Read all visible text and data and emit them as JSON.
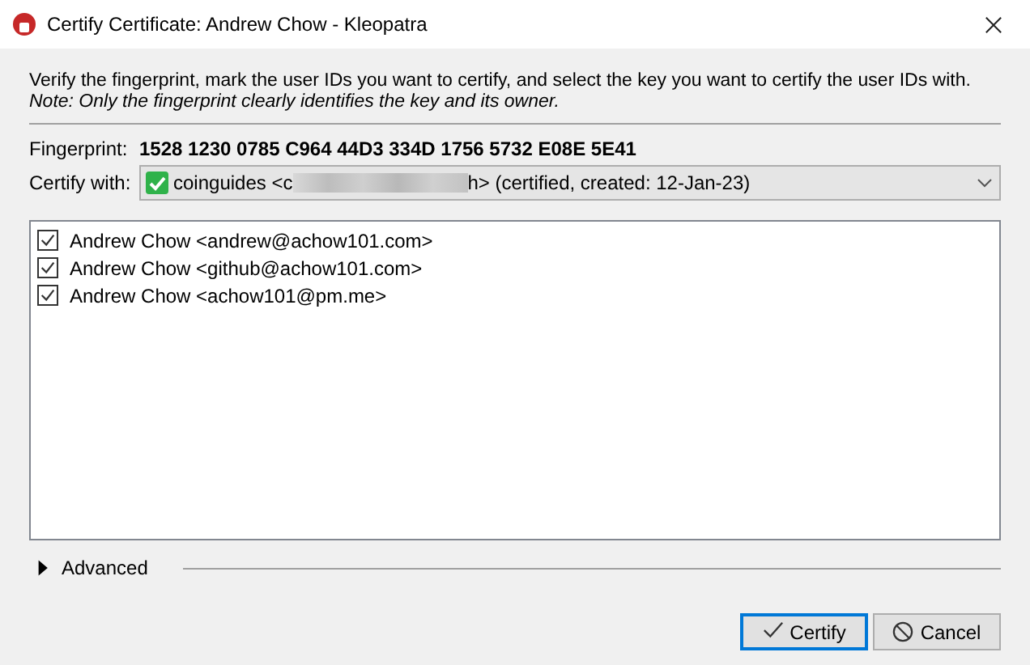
{
  "window": {
    "title": "Certify Certificate: Andrew Chow - Kleopatra"
  },
  "intro": "Verify the fingerprint, mark the user IDs you want to certify, and select the key you want to certify the user IDs with.",
  "note": "Note: Only the fingerprint clearly identifies the key and its owner.",
  "fingerprint": {
    "label": "Fingerprint:",
    "value": "1528 1230 0785 C964 44D3 334D 1756 5732 E08E 5E41"
  },
  "certify_with": {
    "label": "Certify with:",
    "text_before": "coinguides <c",
    "redacted": true,
    "text_after": "h> (certified, created: 12-Jan-23)"
  },
  "user_ids": [
    {
      "label": "Andrew Chow <andrew@achow101.com>",
      "checked": true
    },
    {
      "label": "Andrew Chow <github@achow101.com>",
      "checked": true
    },
    {
      "label": "Andrew Chow <achow101@pm.me>",
      "checked": true
    }
  ],
  "advanced": {
    "label": "Advanced",
    "expanded": false
  },
  "buttons": [
    {
      "kind": "ok",
      "label": "Certify",
      "default": true
    },
    {
      "kind": "cancel",
      "label": "Cancel",
      "default": false
    }
  ]
}
